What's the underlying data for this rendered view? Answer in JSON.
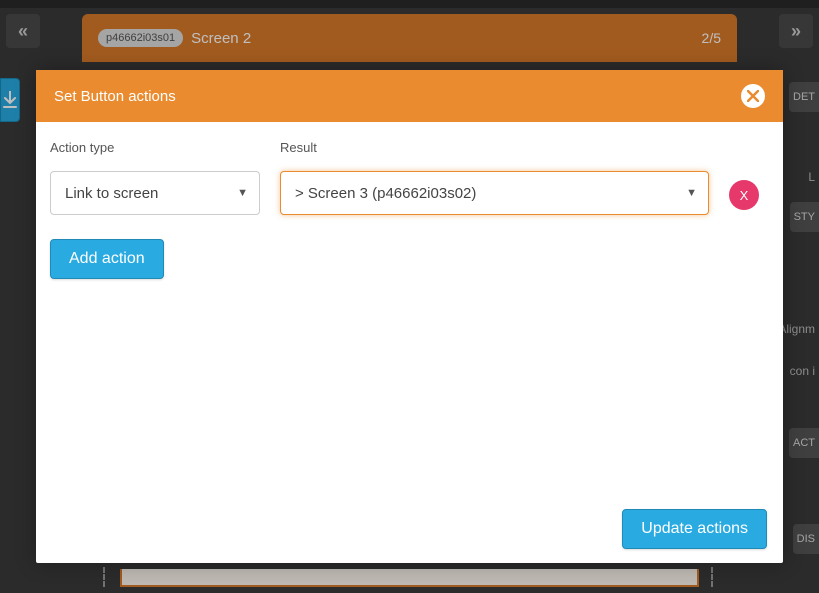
{
  "background": {
    "screen_id": "p46662i03s01",
    "screen_name": "Screen 2",
    "screen_count": "2/5",
    "prev_icon": "«",
    "next_icon": "»",
    "right_tabs": {
      "det": "DET",
      "l": "L",
      "sty": "STY",
      "align": "Alignm",
      "icon": "con i",
      "act": "ACT",
      "dis": "DIS"
    }
  },
  "modal": {
    "title": "Set Button actions",
    "labels": {
      "action_type": "Action type",
      "result": "Result"
    },
    "action_type_value": "Link to screen",
    "result_value": "> Screen 3 (p46662i03s02)",
    "delete_label": "X",
    "add_action_label": "Add action",
    "update_label": "Update actions"
  }
}
